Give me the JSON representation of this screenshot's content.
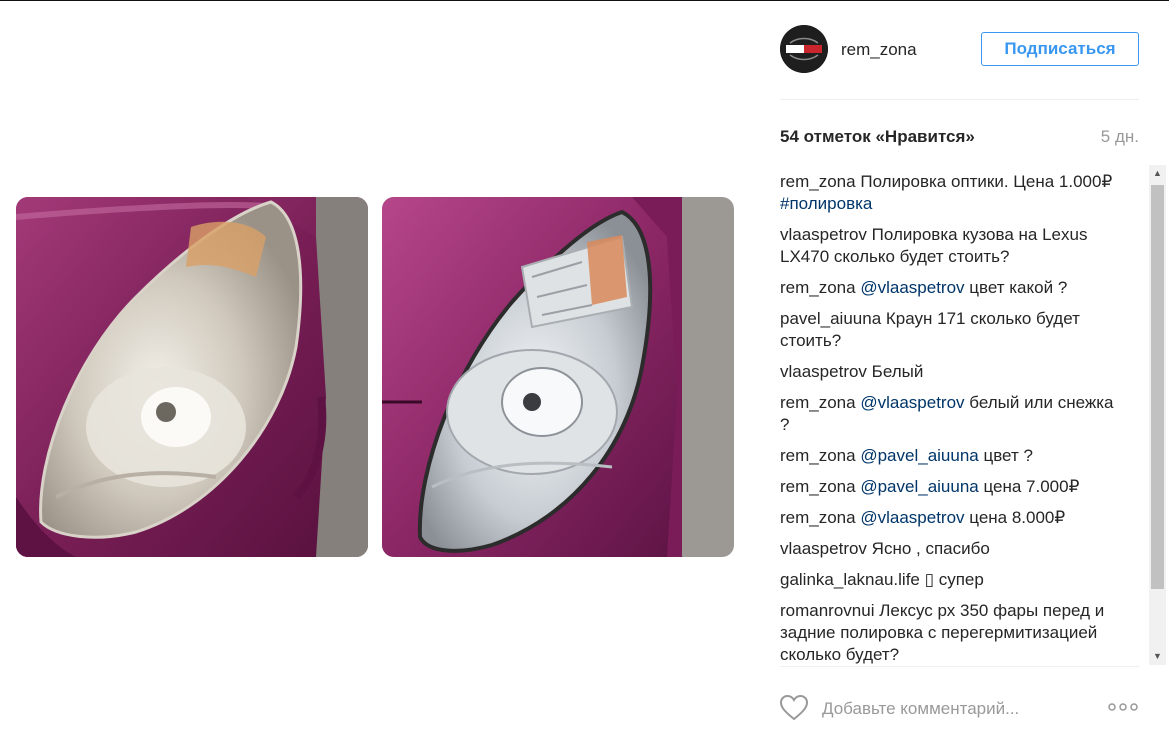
{
  "post": {
    "username": "rem_zona",
    "follow_label": "Подписаться",
    "avatar_icon": "rem-zona-logo",
    "likes_count": "54",
    "likes_prefix": "отметок «",
    "likes_word": "Нравится",
    "likes_suffix": "»",
    "time_ago": "5 дн.",
    "accent_color": "#3897f0",
    "link_color": "#003569"
  },
  "media": {
    "before_photo": "headlight-before-polishing",
    "after_photo": "headlight-after-polishing"
  },
  "comments": [
    {
      "author": "rem_zona",
      "parts": [
        {
          "t": "Полировка оптики. Цена 1.000₽ "
        },
        {
          "t": "#полировка",
          "k": "hashtag"
        }
      ]
    },
    {
      "author": "vlaaspetrov",
      "parts": [
        {
          "t": "Полировка кузова на Lexus LX470 сколько будет стоить?"
        }
      ]
    },
    {
      "author": "rem_zona",
      "parts": [
        {
          "t": "@vlaaspetrov",
          "k": "mention"
        },
        {
          "t": " цвет какой ?"
        }
      ]
    },
    {
      "author": "pavel_aiuuna",
      "parts": [
        {
          "t": "Краун 171 сколько будет стоить?"
        }
      ]
    },
    {
      "author": "vlaaspetrov",
      "parts": [
        {
          "t": "Белый"
        }
      ]
    },
    {
      "author": "rem_zona",
      "parts": [
        {
          "t": "@vlaaspetrov",
          "k": "mention"
        },
        {
          "t": " белый или снежка ?"
        }
      ]
    },
    {
      "author": "rem_zona",
      "parts": [
        {
          "t": "@pavel_aiuuna",
          "k": "mention"
        },
        {
          "t": " цвет ?"
        }
      ]
    },
    {
      "author": "rem_zona",
      "parts": [
        {
          "t": "@pavel_aiuuna",
          "k": "mention"
        },
        {
          "t": " цена 7.000₽"
        }
      ]
    },
    {
      "author": "rem_zona",
      "parts": [
        {
          "t": "@vlaaspetrov",
          "k": "mention"
        },
        {
          "t": " цена 8.000₽"
        }
      ]
    },
    {
      "author": "vlaaspetrov",
      "parts": [
        {
          "t": "Ясно , спасибо"
        }
      ]
    },
    {
      "author": "galinka_laknau.life",
      "parts": [
        {
          "t": "▯ супер"
        }
      ]
    },
    {
      "author": "romanrovnui",
      "parts": [
        {
          "t": "Лексус рх 350 фары перед и задние полировка с перегермитизацией сколько будет?"
        }
      ]
    }
  ],
  "footer": {
    "comment_placeholder": "Добавьте комментарий...",
    "like_icon": "heart-icon",
    "more_icon": "more-options-icon"
  }
}
